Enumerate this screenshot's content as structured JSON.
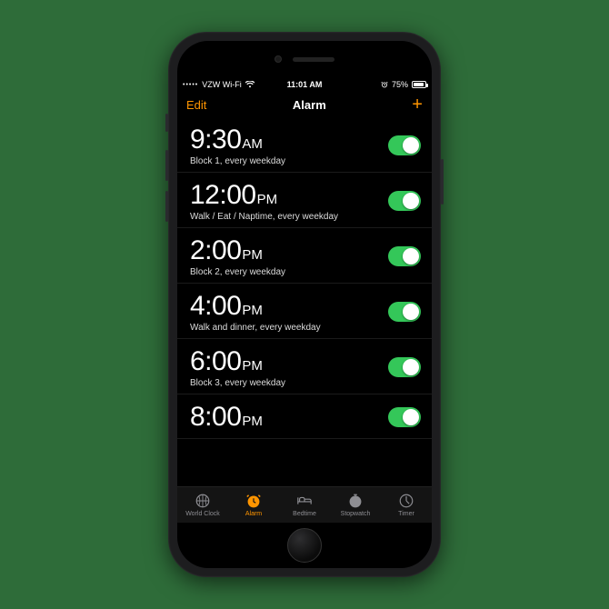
{
  "status_bar": {
    "carrier": "VZW Wi-Fi",
    "time": "11:01 AM",
    "battery_pct": "75%"
  },
  "nav": {
    "edit_label": "Edit",
    "title": "Alarm",
    "add_label": "+"
  },
  "alarms": [
    {
      "time": "9:30",
      "ampm": "AM",
      "desc": "Block 1, every weekday",
      "on": true
    },
    {
      "time": "12:00",
      "ampm": "PM",
      "desc": "Walk / Eat / Naptime, every weekday",
      "on": true
    },
    {
      "time": "2:00",
      "ampm": "PM",
      "desc": "Block 2, every weekday",
      "on": true
    },
    {
      "time": "4:00",
      "ampm": "PM",
      "desc": "Walk and dinner, every weekday",
      "on": true
    },
    {
      "time": "6:00",
      "ampm": "PM",
      "desc": "Block 3, every weekday",
      "on": true
    },
    {
      "time": "8:00",
      "ampm": "PM",
      "desc": "",
      "on": true
    }
  ],
  "tabs": {
    "world_clock": "World Clock",
    "alarm": "Alarm",
    "bedtime": "Bedtime",
    "stopwatch": "Stopwatch",
    "timer": "Timer",
    "active": "alarm"
  }
}
